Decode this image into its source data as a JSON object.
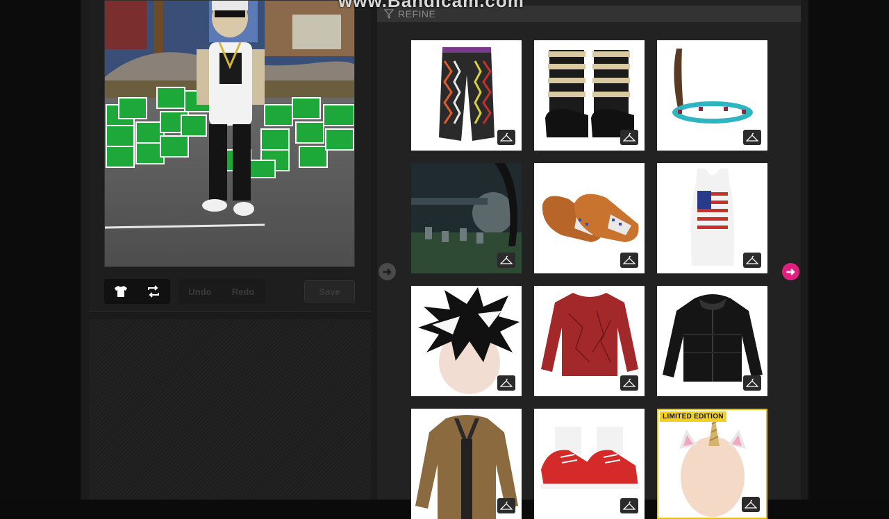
{
  "watermark": "www.Bandicam.com",
  "refine": {
    "label": "REFINE",
    "icon": "filter-icon"
  },
  "toolbar": {
    "undo_label": "Undo",
    "redo_label": "Redo",
    "save_label": "Save"
  },
  "colors": {
    "accent": "#e0207f",
    "limited_badge": "#f3d21e"
  },
  "items": [
    {
      "name": "patterned-pants",
      "icon": "hanger-icon"
    },
    {
      "name": "strapped-boots",
      "icon": "hanger-icon"
    },
    {
      "name": "feather-headband",
      "icon": "hanger-icon"
    },
    {
      "name": "graveyard-background",
      "icon": "hanger-icon"
    },
    {
      "name": "moccasins",
      "icon": "hanger-icon"
    },
    {
      "name": "flag-tank-top",
      "icon": "hanger-icon"
    },
    {
      "name": "spiky-hair",
      "icon": "hanger-icon"
    },
    {
      "name": "red-sweater",
      "icon": "hanger-icon"
    },
    {
      "name": "black-puffer-jacket",
      "icon": "hanger-icon"
    },
    {
      "name": "brown-leather-jacket",
      "icon": "hanger-icon"
    },
    {
      "name": "red-sneakers",
      "icon": "hanger-icon"
    },
    {
      "name": "unicorn-horn-ears",
      "icon": "hanger-icon",
      "badge": "LIMITED EDITION"
    }
  ]
}
